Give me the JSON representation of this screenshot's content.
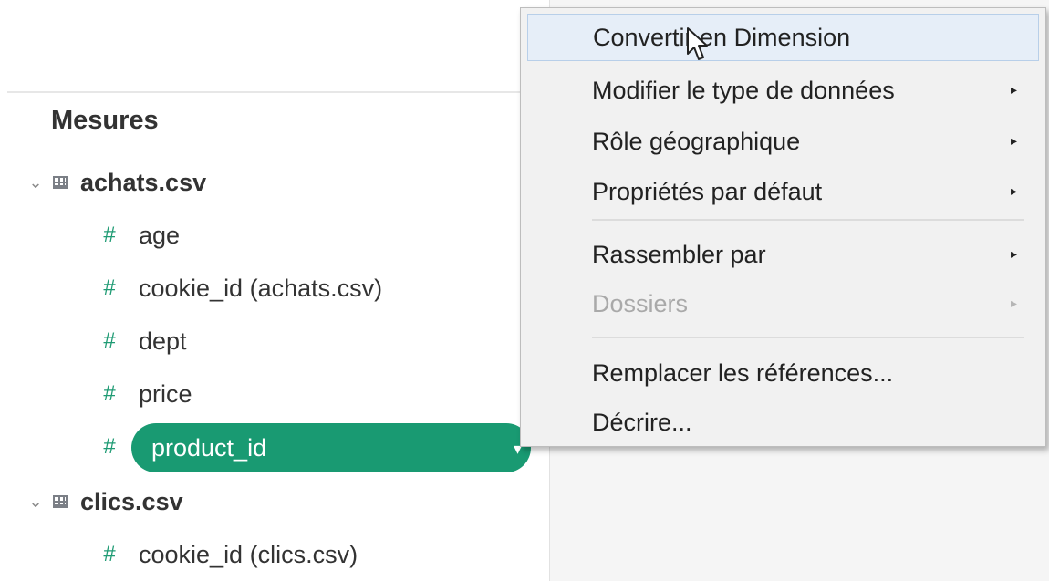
{
  "data_pane": {
    "section_title": "Mesures",
    "tables": [
      {
        "name": "achats.csv",
        "expanded": true,
        "fields": [
          "age",
          "cookie_id (achats.csv)",
          "dept",
          "price",
          "product_id"
        ]
      },
      {
        "name": "clics.csv",
        "expanded": true,
        "fields": [
          "cookie_id (clics.csv)"
        ]
      }
    ],
    "selected_field": "product_id",
    "selected_color": "#199a72"
  },
  "context_menu": {
    "items": [
      {
        "label": "Convertir en Dimension",
        "submenu": false,
        "highlighted": true
      },
      {
        "label": "Modifier le type de données",
        "submenu": true
      },
      {
        "label": "Rôle géographique",
        "submenu": true
      },
      {
        "label": "Propriétés par défaut",
        "submenu": true
      },
      {
        "label": "Rassembler par",
        "submenu": true
      },
      {
        "label": "Dossiers",
        "submenu": true,
        "disabled": true
      },
      {
        "label": "Remplacer les références...",
        "submenu": false
      },
      {
        "label": "Décrire...",
        "submenu": false
      }
    ],
    "submenu_arrow": "▸"
  },
  "icons": {
    "chevron": "expand-chevron-icon",
    "table": "table-icon",
    "measure": "measure-hash-icon",
    "cursor": "mouse-pointer-icon"
  }
}
